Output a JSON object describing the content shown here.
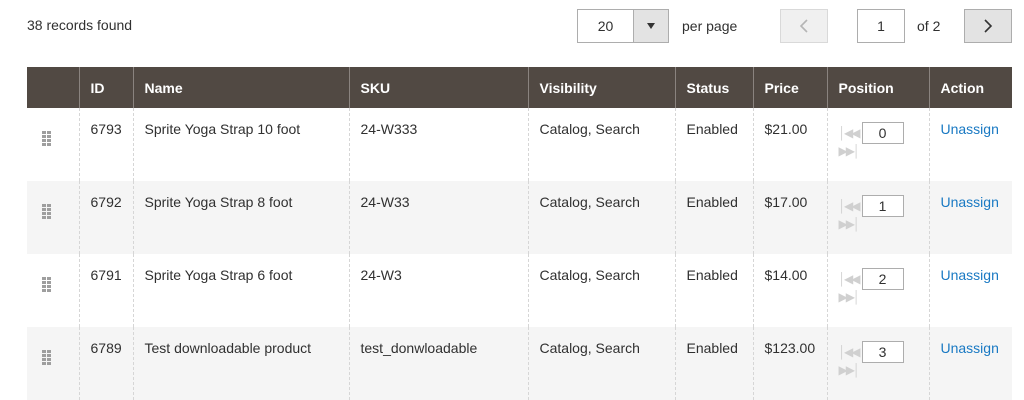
{
  "toolbar": {
    "records_text": "38 records found",
    "per_page_value": "20",
    "per_page_label": "per page",
    "current_page": "1",
    "of_pages": "of 2"
  },
  "columns": [
    "",
    "ID",
    "Name",
    "SKU",
    "Visibility",
    "Status",
    "Price",
    "Position",
    "Action"
  ],
  "rows": [
    {
      "id": "6793",
      "name": "Sprite Yoga Strap 10 foot",
      "sku": "24-W333",
      "visibility": "Catalog, Search",
      "status": "Enabled",
      "price": "$21.00",
      "position": "0",
      "action": "Unassign"
    },
    {
      "id": "6792",
      "name": "Sprite Yoga Strap 8 foot",
      "sku": "24-W33",
      "visibility": "Catalog, Search",
      "status": "Enabled",
      "price": "$17.00",
      "position": "1",
      "action": "Unassign"
    },
    {
      "id": "6791",
      "name": "Sprite Yoga Strap 6 foot",
      "sku": "24-W3",
      "visibility": "Catalog, Search",
      "status": "Enabled",
      "price": "$14.00",
      "position": "2",
      "action": "Unassign"
    },
    {
      "id": "6789",
      "name": "Test downloadable product",
      "sku": "test_donwloadable",
      "visibility": "Catalog, Search",
      "status": "Enabled",
      "price": "$123.00",
      "position": "3",
      "action": "Unassign"
    }
  ]
}
